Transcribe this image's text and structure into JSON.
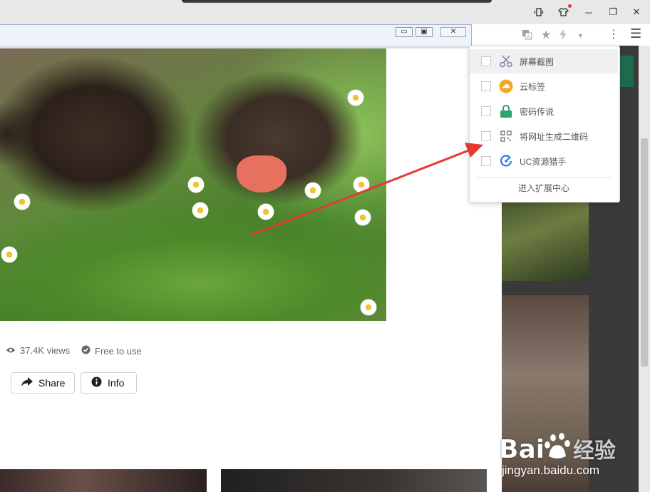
{
  "titlebar": {
    "icons": {
      "phone": "phone-icon",
      "shirt": "shirt-icon",
      "minimize": "─",
      "restore": "❐",
      "close": "✕"
    }
  },
  "inner_window": {
    "minimize": "▭",
    "restore": "▣",
    "close": "✕"
  },
  "photo": {
    "views": "37.4K views",
    "license": "Free to use"
  },
  "actions": {
    "share": "Share",
    "info": "Info"
  },
  "extensions_menu": {
    "items": [
      {
        "label": "屏幕截图",
        "icon": "scissors-icon",
        "checked": false
      },
      {
        "label": "云标签",
        "icon": "cloud-icon",
        "checked": false
      },
      {
        "label": "密码传说",
        "icon": "lock-icon",
        "checked": false
      },
      {
        "label": "将网址生成二维码",
        "icon": "qrcode-icon",
        "checked": false
      },
      {
        "label": "UC资源猎手",
        "icon": "uc-hunter-icon",
        "checked": false
      }
    ],
    "footer": "进入扩展中心"
  },
  "watermark": {
    "logo": "Bai 经验",
    "url": "jingyan.baidu.com"
  },
  "colors": {
    "arrow": "#e53935",
    "cloud": "#f5a623",
    "lock": "#2ea36b",
    "uc": "#2a7de1"
  }
}
